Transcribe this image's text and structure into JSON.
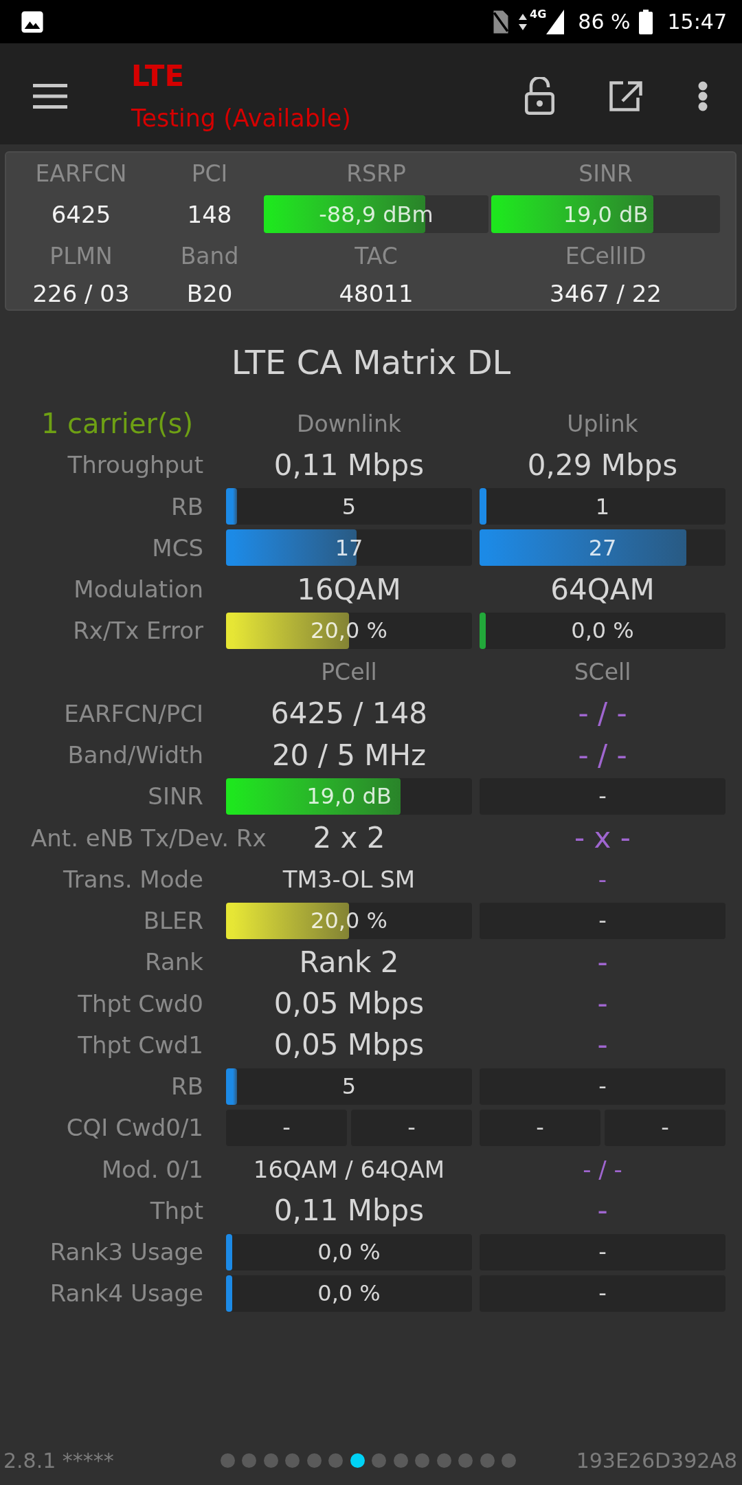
{
  "status_bar": {
    "network": "4G",
    "battery": "86 %",
    "time": "15:47"
  },
  "app_bar": {
    "title": "LTE",
    "subtitle": "Testing (Available)"
  },
  "signal_panel": [
    {
      "kind": "text",
      "label": "EARFCN",
      "value": "6425"
    },
    {
      "kind": "text",
      "label": "PCI",
      "value": "148"
    },
    {
      "kind": "bar",
      "label": "RSRP",
      "value": "-88,9 dBm",
      "level": 0.72,
      "color": "#1ee61e"
    },
    {
      "kind": "bar",
      "label": "SINR",
      "value": "19,0 dB",
      "level": 0.71,
      "color": "#1ee61e"
    },
    {
      "kind": "text",
      "label": "PLMN",
      "value": "226 / 03"
    },
    {
      "kind": "text",
      "label": "Band",
      "value": "B20"
    },
    {
      "kind": "text",
      "label": "TAC",
      "value": "48011"
    },
    {
      "kind": "text",
      "label": "ECellID",
      "value": "3467 / 22"
    }
  ],
  "matrix": {
    "title": "LTE CA Matrix DL",
    "rows": [
      {
        "kind": "header",
        "label": "1 carrier(s)",
        "columns": [
          "Downlink",
          "Uplink"
        ]
      },
      {
        "kind": "data",
        "label": "Throughput",
        "cells": [
          {
            "kind": "value",
            "text": "0,11 Mbps",
            "available": true
          },
          {
            "kind": "value",
            "text": "0,29 Mbps",
            "available": true
          }
        ]
      },
      {
        "kind": "data",
        "label": "RB",
        "cells": [
          {
            "kind": "bar",
            "text": "5",
            "level": 0.045,
            "color": "#1c8ae6"
          },
          {
            "kind": "bar",
            "text": "1",
            "level": 0.028,
            "color": "#1c8ae6"
          }
        ]
      },
      {
        "kind": "data",
        "label": "MCS",
        "cells": [
          {
            "kind": "bar",
            "text": "17",
            "level": 0.53,
            "color": "#1c8ae6"
          },
          {
            "kind": "bar",
            "text": "27",
            "level": 0.84,
            "color": "#1c8ae6"
          }
        ]
      },
      {
        "kind": "data",
        "label": "Modulation",
        "cells": [
          {
            "kind": "value",
            "text": "16QAM",
            "available": true
          },
          {
            "kind": "value",
            "text": "64QAM",
            "available": true
          }
        ]
      },
      {
        "kind": "data",
        "label": "Rx/Tx Error",
        "cells": [
          {
            "kind": "bar",
            "text": "20,0 %",
            "level": 0.5,
            "color": "#e6e635"
          },
          {
            "kind": "bar",
            "text": "0,0 %",
            "level": 0.025,
            "color": "#22a83a"
          }
        ]
      },
      {
        "kind": "header",
        "columns": [
          "PCell",
          "SCell"
        ]
      },
      {
        "kind": "data",
        "label": "EARFCN/PCI",
        "cells": [
          {
            "kind": "value",
            "text": "6425 / 148",
            "available": true
          },
          {
            "kind": "value",
            "text": "- / -",
            "available": false
          }
        ]
      },
      {
        "kind": "data",
        "label": "Band/Width",
        "cells": [
          {
            "kind": "value",
            "text": "20 / 5 MHz",
            "available": true
          },
          {
            "kind": "value",
            "text": "- / -",
            "available": false
          }
        ]
      },
      {
        "kind": "data",
        "label": "SINR",
        "cells": [
          {
            "kind": "bar",
            "text": "19,0 dB",
            "level": 0.71,
            "color": "#1ee61e"
          },
          {
            "kind": "box",
            "text": "-"
          }
        ]
      },
      {
        "kind": "data",
        "label": "Ant. eNB Tx/Dev. Rx",
        "cells": [
          {
            "kind": "value",
            "text": "2 x 2",
            "available": true
          },
          {
            "kind": "value",
            "text": "- x -",
            "available": false
          }
        ]
      },
      {
        "kind": "data",
        "label": "Trans. Mode",
        "cells": [
          {
            "kind": "small",
            "text": "TM3-OL SM",
            "available": true
          },
          {
            "kind": "small",
            "text": "-",
            "available": false
          }
        ]
      },
      {
        "kind": "data",
        "label": "BLER",
        "cells": [
          {
            "kind": "bar",
            "text": "20,0 %",
            "level": 0.5,
            "color": "#e6e635"
          },
          {
            "kind": "box",
            "text": "-"
          }
        ]
      },
      {
        "kind": "data",
        "label": "Rank",
        "cells": [
          {
            "kind": "value",
            "text": "Rank 2",
            "available": true
          },
          {
            "kind": "value",
            "text": "-",
            "available": false
          }
        ]
      },
      {
        "kind": "data",
        "label": "Thpt Cwd0",
        "cells": [
          {
            "kind": "value",
            "text": "0,05 Mbps",
            "available": true
          },
          {
            "kind": "value",
            "text": "-",
            "available": false
          }
        ]
      },
      {
        "kind": "data",
        "label": "Thpt Cwd1",
        "cells": [
          {
            "kind": "value",
            "text": "0,05 Mbps",
            "available": true
          },
          {
            "kind": "value",
            "text": "-",
            "available": false
          }
        ]
      },
      {
        "kind": "data",
        "label": "RB",
        "cells": [
          {
            "kind": "bar",
            "text": "5",
            "level": 0.045,
            "color": "#1c8ae6"
          },
          {
            "kind": "box",
            "text": "-"
          }
        ]
      },
      {
        "kind": "data",
        "label": "CQI Cwd0/1",
        "cells": [
          {
            "kind": "pair",
            "texts": [
              "-",
              "-"
            ]
          },
          {
            "kind": "pair",
            "texts": [
              "-",
              "-"
            ]
          }
        ]
      },
      {
        "kind": "data",
        "label": "Mod. 0/1",
        "cells": [
          {
            "kind": "small",
            "text": "16QAM / 64QAM",
            "available": true
          },
          {
            "kind": "small",
            "text": "- / -",
            "available": false
          }
        ]
      },
      {
        "kind": "data",
        "label": "Thpt",
        "cells": [
          {
            "kind": "value",
            "text": "0,11 Mbps",
            "available": true
          },
          {
            "kind": "value",
            "text": "-",
            "available": false
          }
        ]
      },
      {
        "kind": "data",
        "label": "Rank3 Usage",
        "cells": [
          {
            "kind": "bar",
            "text": "0,0 %",
            "level": 0.025,
            "color": "#1c8ae6"
          },
          {
            "kind": "box",
            "text": "-"
          }
        ]
      },
      {
        "kind": "data",
        "label": "Rank4 Usage",
        "cells": [
          {
            "kind": "bar",
            "text": "0,0 %",
            "level": 0.025,
            "color": "#1c8ae6"
          },
          {
            "kind": "box",
            "text": "-"
          }
        ]
      }
    ]
  },
  "footer": {
    "version": "2.8.1 *****",
    "pages": [
      {
        "selected": false
      },
      {
        "selected": false
      },
      {
        "selected": false
      },
      {
        "selected": false
      },
      {
        "selected": false
      },
      {
        "selected": false
      },
      {
        "selected": true
      },
      {
        "selected": false
      },
      {
        "selected": false
      },
      {
        "selected": false
      },
      {
        "selected": false
      },
      {
        "selected": false
      },
      {
        "selected": false
      },
      {
        "selected": false
      }
    ],
    "device_id": "193E26D392A8"
  }
}
